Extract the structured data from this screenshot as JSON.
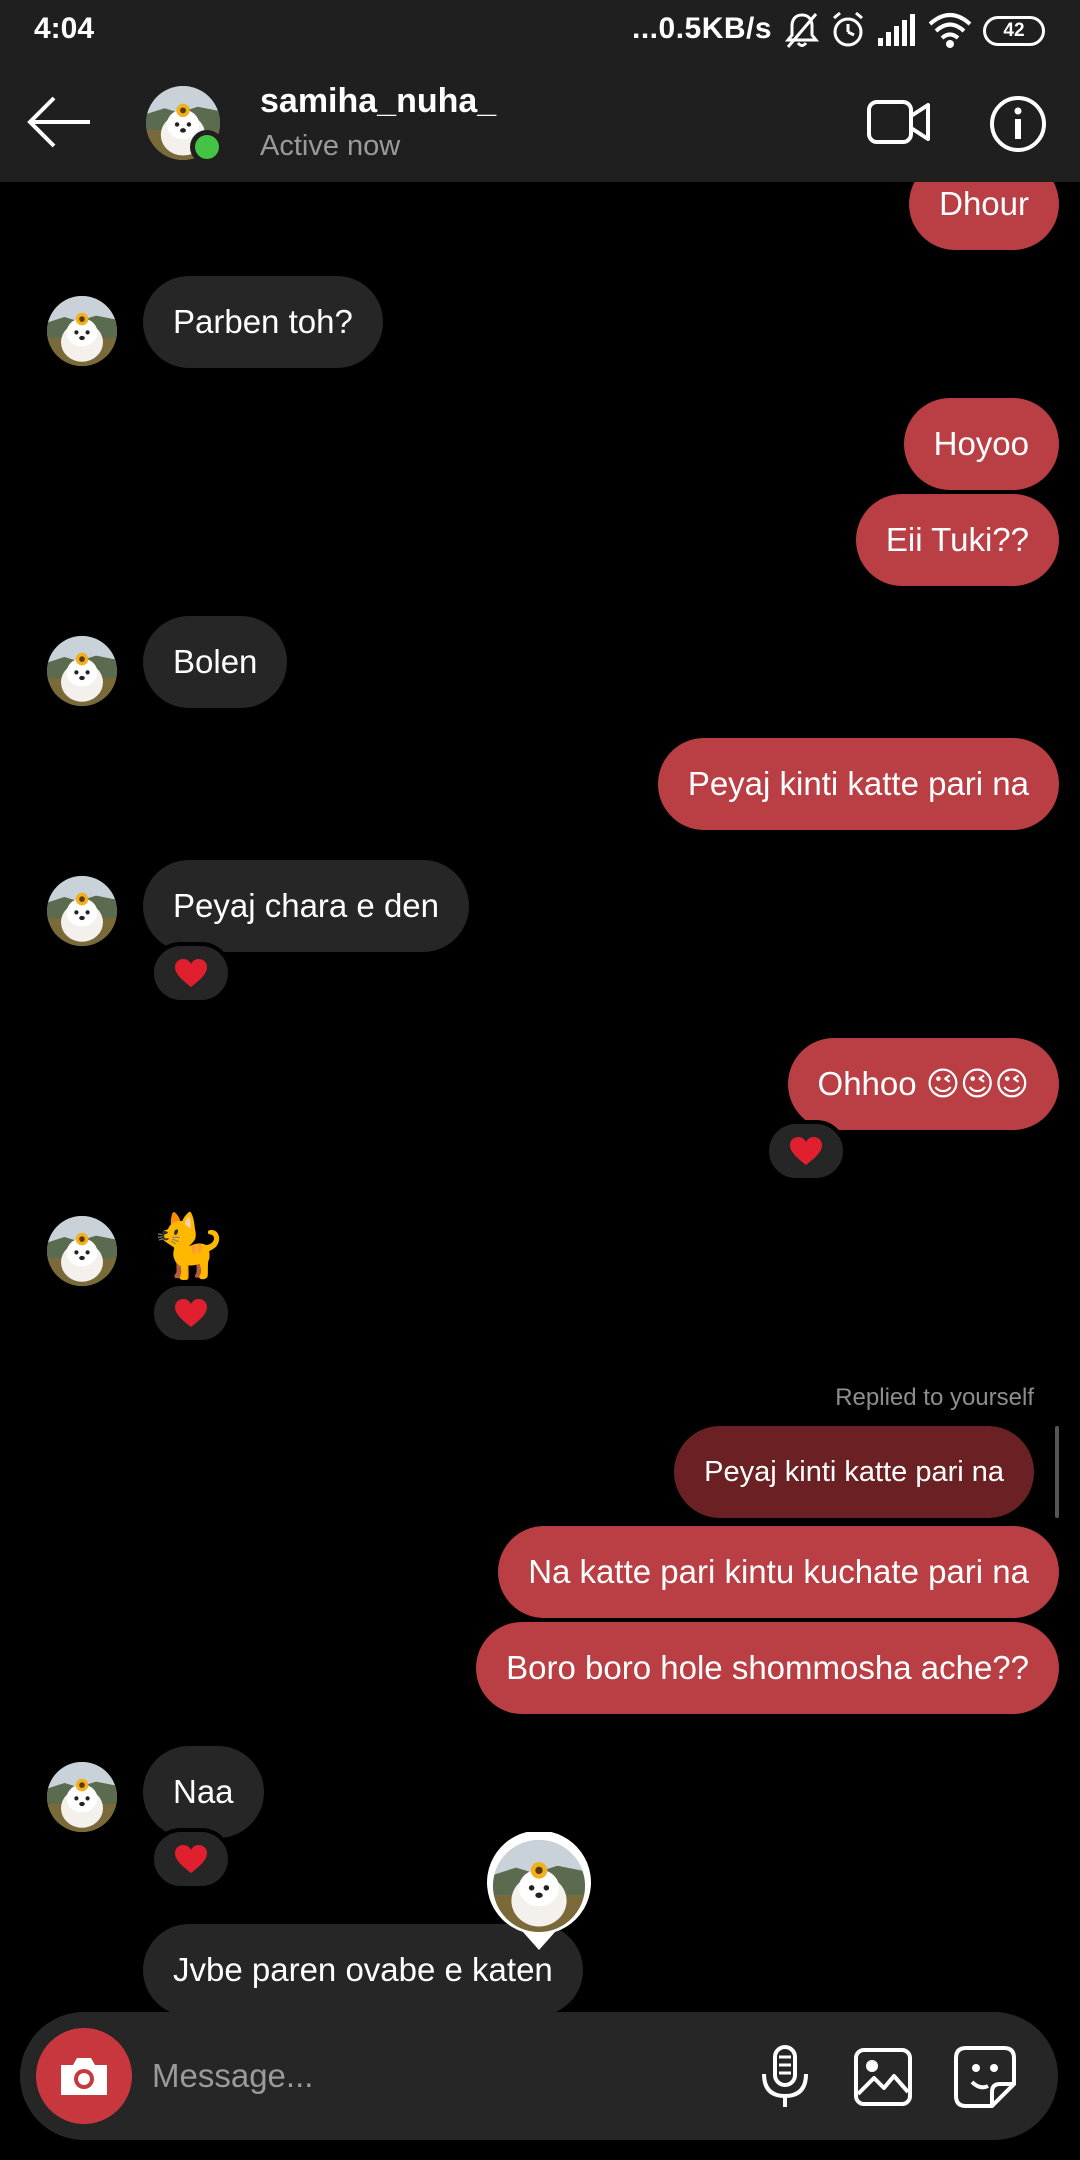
{
  "status_bar": {
    "time": "4:04",
    "network_speed": "...0.5KB/s",
    "battery_level": "42",
    "icons": [
      "mute-bell-icon",
      "alarm-icon",
      "signal-icon",
      "wifi-icon",
      "battery-icon"
    ]
  },
  "header": {
    "username": "samiha_nuha_",
    "activity": "Active now",
    "icons": [
      "back-arrow-icon",
      "video-call-icon",
      "info-icon"
    ]
  },
  "messages": {
    "m1": "Dhour",
    "m2": "Parben toh?",
    "m3": "Hoyoo",
    "m4": "Eii Tuki??",
    "m5": "Bolen",
    "m6": "Peyaj kinti katte pari na",
    "m7": "Peyaj chara e den",
    "m8": "Ohhoo 😉😉😉",
    "m9": "🐈",
    "m10_replied_label": "Replied to yourself",
    "m10_quoted": "Peyaj kinti katte pari na",
    "m10": "Na katte pari kintu kuchate pari na",
    "m11": "Boro boro hole shommosha ache??",
    "m12": "Naa",
    "m13": "Jvbe paren ovabe e katen"
  },
  "reactions": {
    "heart": "heart-reaction-icon"
  },
  "composer": {
    "placeholder": "Message...",
    "icons": [
      "camera-icon",
      "microphone-icon",
      "gallery-icon",
      "sticker-icon"
    ]
  },
  "colors": {
    "outgoing_bubble": "#b93f44",
    "incoming_bubble": "#262626",
    "header_bg": "#1f1f1f",
    "camera_button": "#c8373d",
    "online_dot": "#44c344"
  }
}
